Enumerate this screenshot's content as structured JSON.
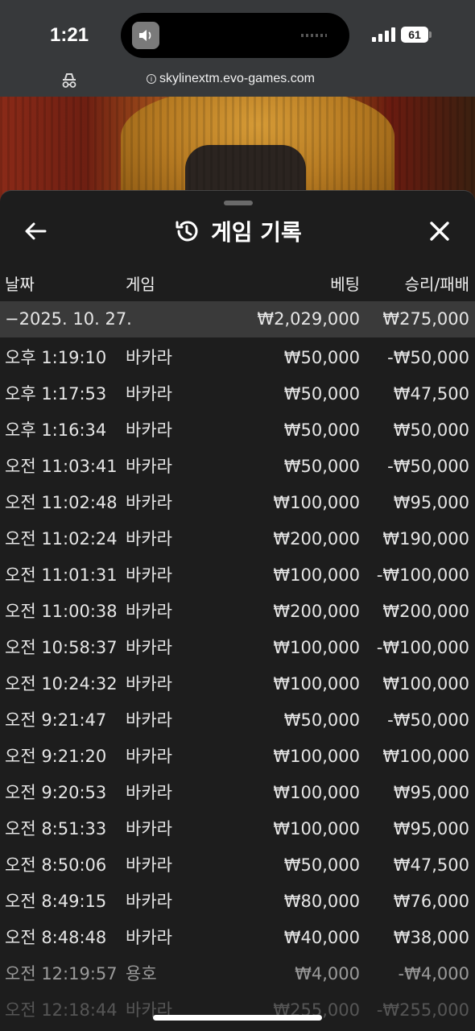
{
  "status_bar": {
    "time": "1:21",
    "battery": "61"
  },
  "browser": {
    "url": "skylinextm.evo-games.com"
  },
  "panel": {
    "title": "게임 기록",
    "columns": {
      "date": "날짜",
      "game": "게임",
      "bet": "베팅",
      "result": "승리/패배"
    },
    "summary": {
      "date": "−2025. 10. 27.",
      "bet": "₩2,029,000",
      "result": "₩275,000"
    },
    "rows": [
      {
        "time": "오후 1:19:10",
        "game": "바카라",
        "bet": "₩50,000",
        "result": "-₩50,000"
      },
      {
        "time": "오후 1:17:53",
        "game": "바카라",
        "bet": "₩50,000",
        "result": "₩47,500"
      },
      {
        "time": "오후 1:16:34",
        "game": "바카라",
        "bet": "₩50,000",
        "result": "₩50,000"
      },
      {
        "time": "오전 11:03:41",
        "game": "바카라",
        "bet": "₩50,000",
        "result": "-₩50,000"
      },
      {
        "time": "오전 11:02:48",
        "game": "바카라",
        "bet": "₩100,000",
        "result": "₩95,000"
      },
      {
        "time": "오전 11:02:24",
        "game": "바카라",
        "bet": "₩200,000",
        "result": "₩190,000"
      },
      {
        "time": "오전 11:01:31",
        "game": "바카라",
        "bet": "₩100,000",
        "result": "-₩100,000"
      },
      {
        "time": "오전 11:00:38",
        "game": "바카라",
        "bet": "₩200,000",
        "result": "₩200,000"
      },
      {
        "time": "오전 10:58:37",
        "game": "바카라",
        "bet": "₩100,000",
        "result": "-₩100,000"
      },
      {
        "time": "오전 10:24:32",
        "game": "바카라",
        "bet": "₩100,000",
        "result": "₩100,000"
      },
      {
        "time": "오전 9:21:47",
        "game": "바카라",
        "bet": "₩50,000",
        "result": "-₩50,000"
      },
      {
        "time": "오전 9:21:20",
        "game": "바카라",
        "bet": "₩100,000",
        "result": "₩100,000"
      },
      {
        "time": "오전 9:20:53",
        "game": "바카라",
        "bet": "₩100,000",
        "result": "₩95,000"
      },
      {
        "time": "오전 8:51:33",
        "game": "바카라",
        "bet": "₩100,000",
        "result": "₩95,000"
      },
      {
        "time": "오전 8:50:06",
        "game": "바카라",
        "bet": "₩50,000",
        "result": "₩47,500"
      },
      {
        "time": "오전 8:49:15",
        "game": "바카라",
        "bet": "₩80,000",
        "result": "₩76,000"
      },
      {
        "time": "오전 8:48:48",
        "game": "바카라",
        "bet": "₩40,000",
        "result": "₩38,000"
      },
      {
        "time": "오전 12:19:57",
        "game": "용호",
        "bet": "₩4,000",
        "result": "-₩4,000"
      },
      {
        "time": "오전 12:18:44",
        "game": "바카라",
        "bet": "₩255,000",
        "result": "-₩255,000"
      }
    ]
  },
  "icons": {
    "back": "arrow-left-icon",
    "history": "history-icon",
    "close": "close-icon",
    "incognito": "incognito-icon",
    "info": "info-icon"
  }
}
